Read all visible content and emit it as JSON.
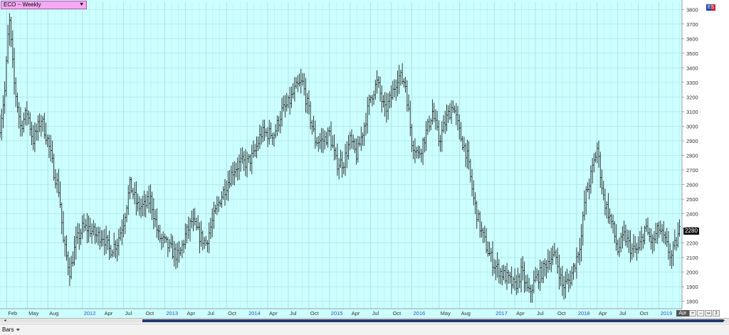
{
  "header": {
    "symbol_label": "ECO ~ Weekly",
    "dropdown_icon": "chevron-down-icon",
    "flag_text": "ES",
    "last_price": "2280"
  },
  "footer": {
    "date_badge": "Apr",
    "zoom_buttons": [
      "+",
      "−",
      "↔",
      "↕"
    ],
    "scroll_left": "◂",
    "scroll_right": "▸",
    "tab_label": "Bars",
    "tab_icon": "glasses-icon"
  },
  "colors": {
    "plot_bg": "#ccffff",
    "grid": "#a8dde6",
    "bar": "#222222",
    "axis_text": "#333333",
    "year_text": "#2a4fbf"
  },
  "chart_data": {
    "type": "ohlc-bar",
    "title": "ECO ~ Weekly",
    "x_range": [
      "2011-02",
      "2019-04"
    ],
    "ylim": [
      1750,
      3850
    ],
    "y_ticks": [
      1800,
      1900,
      2000,
      2100,
      2200,
      2300,
      2400,
      2500,
      2600,
      2700,
      2800,
      2900,
      3000,
      3100,
      3200,
      3300,
      3400,
      3500,
      3600,
      3700,
      3800
    ],
    "x_ticks": [
      {
        "t": 2011.08,
        "label": "Feb",
        "year": false
      },
      {
        "t": 2011.33,
        "label": "May",
        "year": false
      },
      {
        "t": 2011.58,
        "label": "Aug",
        "year": false
      },
      {
        "t": 2012.0,
        "label": "2012",
        "year": true
      },
      {
        "t": 2012.25,
        "label": "Apr",
        "year": false
      },
      {
        "t": 2012.5,
        "label": "Jul",
        "year": false
      },
      {
        "t": 2012.75,
        "label": "Oct",
        "year": false
      },
      {
        "t": 2013.0,
        "label": "2013",
        "year": true
      },
      {
        "t": 2013.25,
        "label": "Apr",
        "year": false
      },
      {
        "t": 2013.5,
        "label": "Jul",
        "year": false
      },
      {
        "t": 2013.75,
        "label": "Oct",
        "year": false
      },
      {
        "t": 2014.0,
        "label": "2014",
        "year": true
      },
      {
        "t": 2014.25,
        "label": "Apr",
        "year": false
      },
      {
        "t": 2014.5,
        "label": "Jul",
        "year": false
      },
      {
        "t": 2014.75,
        "label": "Oct",
        "year": false
      },
      {
        "t": 2015.0,
        "label": "2015",
        "year": true
      },
      {
        "t": 2015.25,
        "label": "Apr",
        "year": false
      },
      {
        "t": 2015.5,
        "label": "Jul",
        "year": false
      },
      {
        "t": 2015.75,
        "label": "Oct",
        "year": false
      },
      {
        "t": 2016.0,
        "label": "2016",
        "year": true
      },
      {
        "t": 2016.33,
        "label": "May",
        "year": false
      },
      {
        "t": 2016.58,
        "label": "Aug",
        "year": false
      },
      {
        "t": 2017.0,
        "label": "2017",
        "year": true
      },
      {
        "t": 2017.25,
        "label": "Apr",
        "year": false
      },
      {
        "t": 2017.5,
        "label": "Jul",
        "year": false
      },
      {
        "t": 2017.75,
        "label": "Oct",
        "year": false
      },
      {
        "t": 2018.0,
        "label": "2018",
        "year": true
      },
      {
        "t": 2018.25,
        "label": "Apr",
        "year": false
      },
      {
        "t": 2018.5,
        "label": "Jul",
        "year": false
      },
      {
        "t": 2018.75,
        "label": "Oct",
        "year": false
      },
      {
        "t": 2019.0,
        "label": "2019",
        "year": true
      }
    ],
    "series": [
      {
        "price_path": [
          [
            2011.0,
            3000
          ],
          [
            2011.06,
            3250
          ],
          [
            2011.11,
            3750
          ],
          [
            2011.17,
            3300
          ],
          [
            2011.25,
            3000
          ],
          [
            2011.33,
            3100
          ],
          [
            2011.4,
            2900
          ],
          [
            2011.5,
            3050
          ],
          [
            2011.58,
            2900
          ],
          [
            2011.65,
            2700
          ],
          [
            2011.72,
            2550
          ],
          [
            2011.77,
            2200
          ],
          [
            2011.85,
            2000
          ],
          [
            2011.92,
            2200
          ],
          [
            2012.0,
            2300
          ],
          [
            2012.08,
            2300
          ],
          [
            2012.17,
            2250
          ],
          [
            2012.25,
            2250
          ],
          [
            2012.33,
            2150
          ],
          [
            2012.42,
            2200
          ],
          [
            2012.5,
            2350
          ],
          [
            2012.58,
            2600
          ],
          [
            2012.67,
            2450
          ],
          [
            2012.75,
            2450
          ],
          [
            2012.83,
            2500
          ],
          [
            2012.92,
            2250
          ],
          [
            2013.0,
            2200
          ],
          [
            2013.08,
            2150
          ],
          [
            2013.17,
            2100
          ],
          [
            2013.25,
            2250
          ],
          [
            2013.33,
            2350
          ],
          [
            2013.42,
            2250
          ],
          [
            2013.5,
            2200
          ],
          [
            2013.58,
            2350
          ],
          [
            2013.67,
            2500
          ],
          [
            2013.75,
            2600
          ],
          [
            2013.83,
            2700
          ],
          [
            2013.92,
            2750
          ],
          [
            2014.0,
            2750
          ],
          [
            2014.08,
            2800
          ],
          [
            2014.17,
            2950
          ],
          [
            2014.25,
            2950
          ],
          [
            2014.33,
            2950
          ],
          [
            2014.42,
            3100
          ],
          [
            2014.5,
            3150
          ],
          [
            2014.58,
            3250
          ],
          [
            2014.67,
            3300
          ],
          [
            2014.75,
            3100
          ],
          [
            2014.83,
            2900
          ],
          [
            2014.92,
            2900
          ],
          [
            2015.0,
            2950
          ],
          [
            2015.08,
            2750
          ],
          [
            2015.17,
            2750
          ],
          [
            2015.25,
            2900
          ],
          [
            2015.33,
            2800
          ],
          [
            2015.42,
            3000
          ],
          [
            2015.5,
            3200
          ],
          [
            2015.58,
            3300
          ],
          [
            2015.67,
            3100
          ],
          [
            2015.75,
            3200
          ],
          [
            2015.83,
            3350
          ],
          [
            2015.92,
            3300
          ],
          [
            2016.0,
            2900
          ],
          [
            2016.08,
            2800
          ],
          [
            2016.17,
            2950
          ],
          [
            2016.25,
            3100
          ],
          [
            2016.33,
            2900
          ],
          [
            2016.42,
            3050
          ],
          [
            2016.5,
            3150
          ],
          [
            2016.58,
            2950
          ],
          [
            2016.67,
            2800
          ],
          [
            2016.75,
            2500
          ],
          [
            2016.83,
            2300
          ],
          [
            2016.92,
            2150
          ],
          [
            2017.0,
            2050
          ],
          [
            2017.08,
            2000
          ],
          [
            2017.17,
            1950
          ],
          [
            2017.25,
            1900
          ],
          [
            2017.33,
            2000
          ],
          [
            2017.42,
            1850
          ],
          [
            2017.5,
            1950
          ],
          [
            2017.58,
            2000
          ],
          [
            2017.67,
            2100
          ],
          [
            2017.75,
            2100
          ],
          [
            2017.83,
            1900
          ],
          [
            2017.92,
            1950
          ],
          [
            2018.0,
            2100
          ],
          [
            2018.06,
            2250
          ],
          [
            2018.1,
            2500
          ],
          [
            2018.17,
            2650
          ],
          [
            2018.25,
            2850
          ],
          [
            2018.33,
            2500
          ],
          [
            2018.42,
            2350
          ],
          [
            2018.5,
            2150
          ],
          [
            2018.58,
            2250
          ],
          [
            2018.67,
            2150
          ],
          [
            2018.75,
            2150
          ],
          [
            2018.83,
            2300
          ],
          [
            2018.92,
            2200
          ],
          [
            2019.0,
            2300
          ],
          [
            2019.08,
            2200
          ],
          [
            2019.15,
            2100
          ],
          [
            2019.25,
            2280
          ]
        ]
      }
    ]
  }
}
